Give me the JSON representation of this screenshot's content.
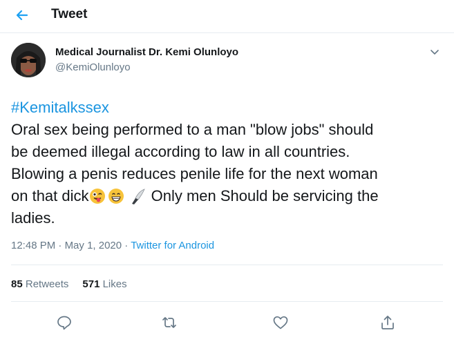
{
  "header": {
    "title": "Tweet",
    "back_icon": "arrow-left-icon"
  },
  "author": {
    "display_name": "Medical Journalist Dr. Kemi Olunloyo",
    "handle": "@KemiOlunloyo"
  },
  "tweet": {
    "hashtag": "#Kemitalkssex",
    "lines": [
      "Oral sex being performed to a man \"blow jobs\" should",
      "be deemed illegal according to law in all countries.",
      "Blowing a penis reduces penile life for the next woman",
      "on that dick",
      " Only men Should be servicing the",
      "ladies."
    ],
    "emojis": [
      "winking-face-tongue-emoji",
      "grinning-face-emoji",
      "kitchen-knife-emoji"
    ]
  },
  "meta": {
    "time": "12:48 PM",
    "separator": "·",
    "date": "May 1, 2020",
    "source": "Twitter for Android"
  },
  "stats": {
    "retweets_count": "85",
    "retweets_label": "Retweets",
    "likes_count": "571",
    "likes_label": "Likes"
  },
  "actions": [
    "reply-icon",
    "retweet-icon",
    "like-icon",
    "share-icon"
  ],
  "colors": {
    "accent": "#1da1f2",
    "link": "#1b95e0",
    "secondary_text": "#657786",
    "border": "#e6ecf0"
  }
}
